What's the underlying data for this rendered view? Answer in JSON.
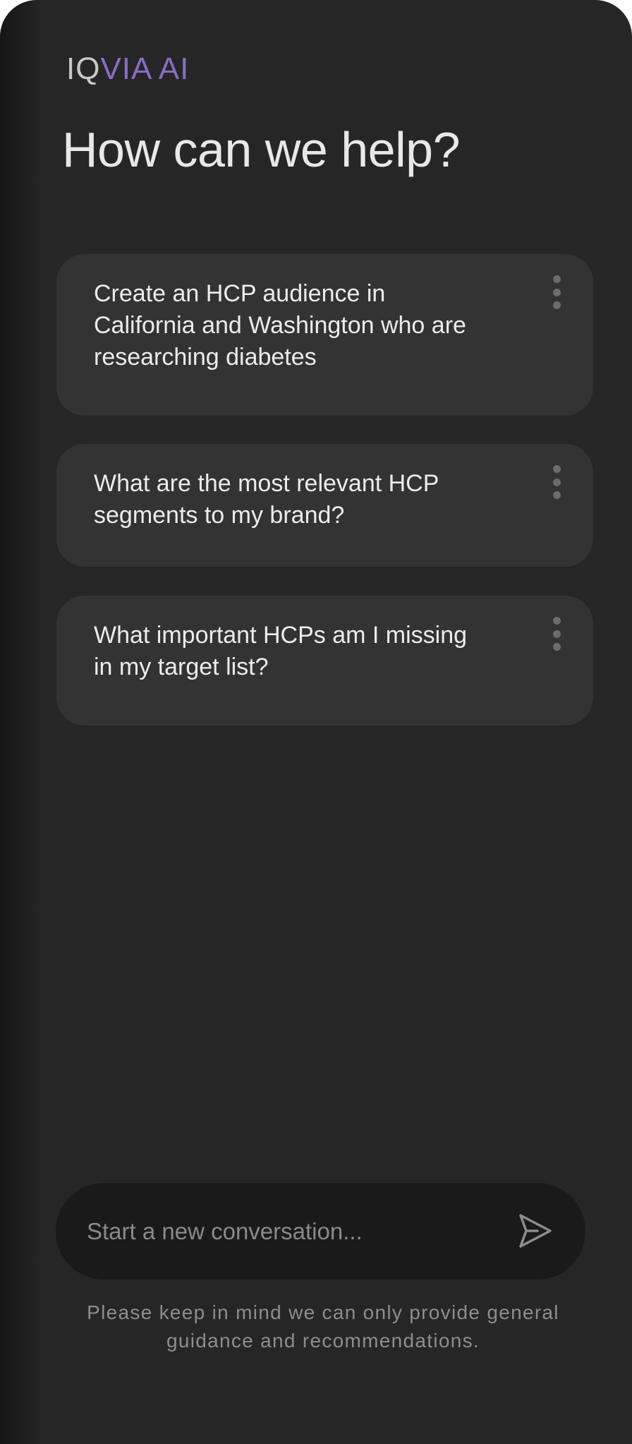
{
  "brand": {
    "prefix": "IQ",
    "suffix": "VIA AI",
    "accent_color": "#8a6cc4"
  },
  "heading": "How can we help?",
  "suggestions": [
    {
      "text": "Create an HCP audience in California and Washington who are researching diabetes",
      "menu_icon": "more-vertical-icon"
    },
    {
      "text": "What are the most relevant HCP segments to my brand?",
      "menu_icon": "more-vertical-icon"
    },
    {
      "text": "What important HCPs am I missing in my target list?",
      "menu_icon": "more-vertical-icon"
    }
  ],
  "composer": {
    "placeholder": "Start a new conversation...",
    "value": "",
    "send_icon": "send-icon"
  },
  "disclaimer": "Please keep in mind we can only provide general guidance and recommendations.",
  "colors": {
    "background": "#262626",
    "card": "#333333",
    "input": "#1a1a1a",
    "text": "#ececec",
    "muted": "#8d8d8d"
  }
}
